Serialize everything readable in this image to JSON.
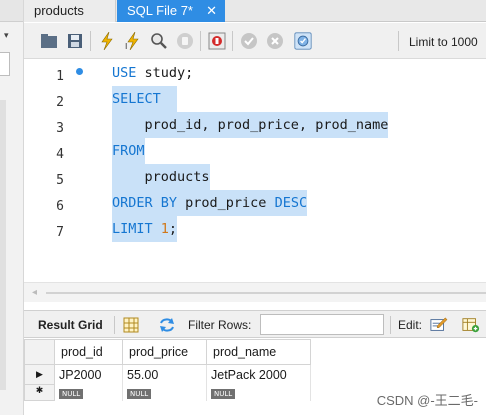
{
  "tabs": [
    {
      "label": "products",
      "active": false
    },
    {
      "label": "SQL File 7*",
      "active": true
    }
  ],
  "toolbar": {
    "icons": [
      "open-folder-icon",
      "save-icon",
      "execute-lightning-icon",
      "execute-cursor-lightning-icon",
      "explain-magnifier-icon",
      "stop-icon",
      "toggle-error-icon",
      "commit-check-icon",
      "rollback-icon",
      "autocommit-icon"
    ],
    "limit_label": "Limit to 1000"
  },
  "editor": {
    "line_numbers": [
      "1",
      "2",
      "3",
      "4",
      "5",
      "6",
      "7"
    ],
    "lines": [
      {
        "kw1": "USE",
        "rest": " study;"
      },
      {
        "kw1": "SELECT",
        "rest": ""
      },
      {
        "kw1": "",
        "rest": "    prod_id, prod_price, prod_name"
      },
      {
        "kw1": "FROM",
        "rest": ""
      },
      {
        "kw1": "",
        "rest": "    products"
      },
      {
        "kw1": "ORDER BY",
        "mid": " prod_price ",
        "kw2": "DESC"
      },
      {
        "kw1": "LIMIT",
        "space": " ",
        "num": "1",
        "tail": ";"
      }
    ]
  },
  "result_toolbar": {
    "result_grid_label": "Result Grid",
    "filter_rows_label": "Filter Rows:",
    "filter_value": "",
    "edit_label": "Edit:"
  },
  "grid": {
    "columns": [
      "prod_id",
      "prod_price",
      "prod_name"
    ],
    "rows": [
      [
        "JP2000",
        "55.00",
        "JetPack 2000"
      ]
    ],
    "null_label": "NULL"
  },
  "watermark": "CSDN @-王二毛-",
  "colors": {
    "accent": "#2f8de4",
    "keyword": "#1576d1",
    "selection": "#c9e1f8",
    "number": "#d0781a"
  }
}
